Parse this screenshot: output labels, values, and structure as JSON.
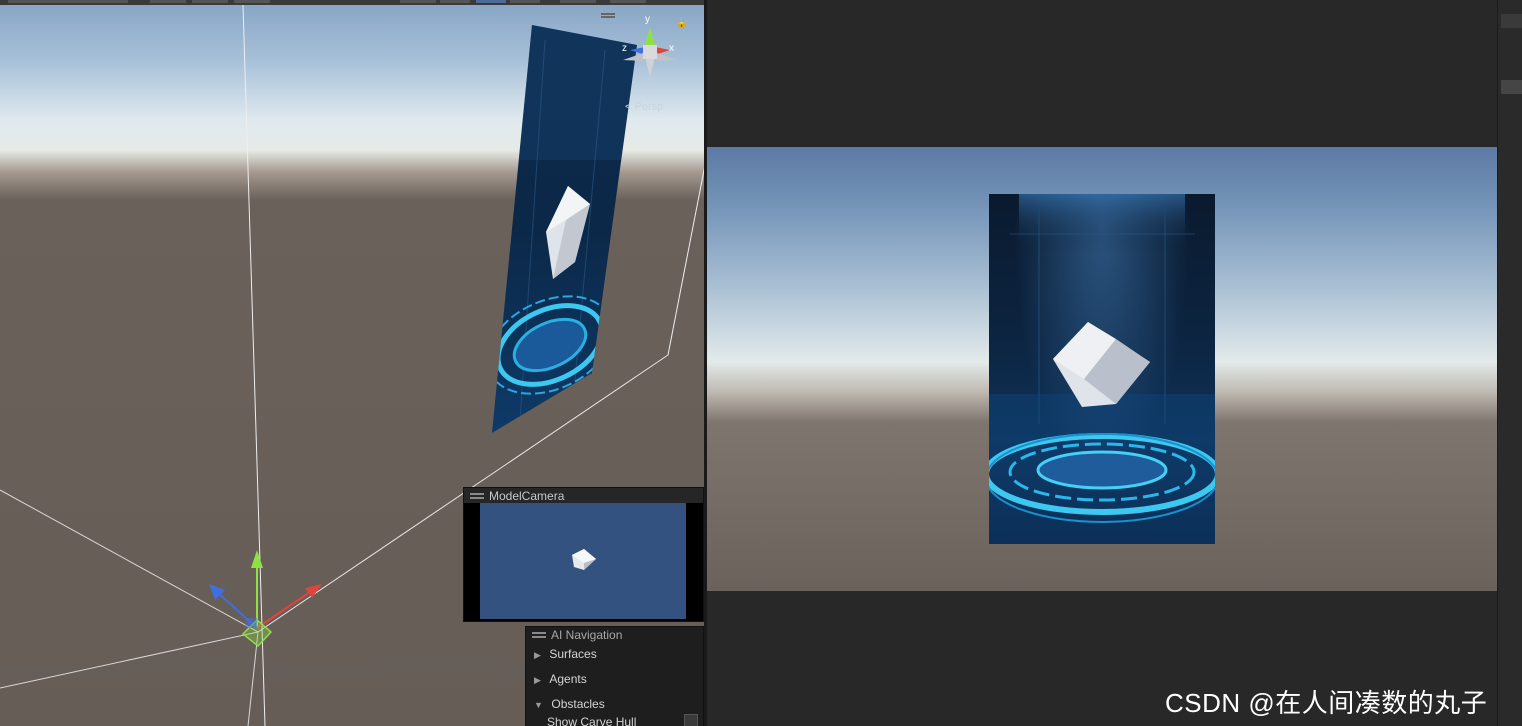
{
  "scene_view": {
    "gizmo": {
      "y_label": "y",
      "x_label": "x",
      "z_label": "z",
      "projection": "Persp"
    }
  },
  "model_camera": {
    "title": "ModelCamera"
  },
  "ai_navigation": {
    "title": "AI Navigation",
    "items": [
      {
        "label": "Surfaces",
        "expanded": false
      },
      {
        "label": "Agents",
        "expanded": false
      },
      {
        "label": "Obstacles",
        "expanded": true
      }
    ],
    "option": {
      "label": "Show Carve Hull"
    }
  },
  "watermark": "CSDN @在人间凑数的丸子",
  "icons": {
    "collapsed": "▶",
    "expanded": "▼"
  },
  "colors": {
    "axis_x": "#e0443a",
    "axis_y": "#8fe043",
    "axis_z": "#3f6fe0",
    "ring": "#3dc8f0"
  }
}
